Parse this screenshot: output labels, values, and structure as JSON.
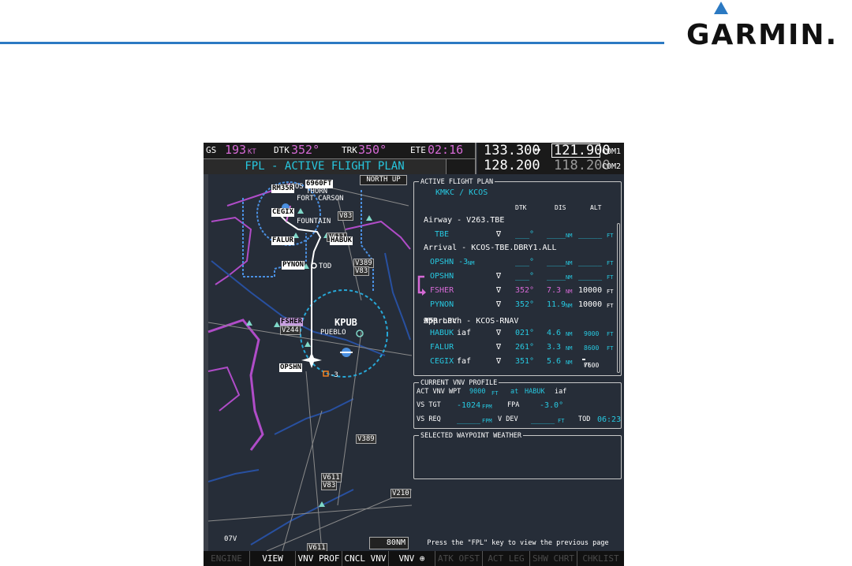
{
  "brand": {
    "logo_text": "GARMIN."
  },
  "navbar": {
    "gs_label": "GS",
    "gs_value": "193",
    "gs_unit": "KT",
    "dtk_label": "DTK",
    "dtk_value": "352°",
    "trk_label": "TRK",
    "trk_value": "350°",
    "ete_label": "ETE",
    "ete_value": "02:16",
    "page_title": "FPL - ACTIVE FLIGHT PLAN"
  },
  "com": {
    "com1_active": "133.300",
    "com1_standby": "121.900",
    "com1_label": "COM1",
    "com2_active": "128.200",
    "com2_standby": "118.200",
    "com2_label": "COM2",
    "swap_symbol": "↔"
  },
  "map": {
    "orientation": "NORTH UP",
    "range": "80NM",
    "labels": {
      "kcos": "KCOS",
      "rm": "RM35R",
      "alt": "6960FT",
      "fort": "FORT CARSON",
      "thorn": "THORN",
      "fountain": "FOUNTAIN",
      "cegix": "CEGIX",
      "falur": "FALUR",
      "habuk": "HABUK",
      "pynon": "PYNON",
      "tod": "TOD",
      "fsher": "FSHER",
      "kpub": "KPUB",
      "pueblo": "PUEBLO",
      "opshn": "OPSHN",
      "minus3": "-3",
      "v83a": "V83",
      "v611": "V611",
      "v389": "V389",
      "v83b": "V83",
      "v389b": "V389",
      "v611b": "V611",
      "v83c": "V83",
      "v210": "V210",
      "v244": "V244",
      "v611c": "V611",
      "o7v": "07V"
    }
  },
  "flight_plan": {
    "title": "ACTIVE FLIGHT PLAN",
    "route": "KMKC / KCOS",
    "col_dtk": "DTK",
    "col_dis": "DIS",
    "col_alt": "ALT",
    "airway_header": "Airway - V263.TBE",
    "arrival_header": "Arrival - KCOS-TBE.DBRY1.ALL",
    "approach_header_a": "Approach - KCOS-RNAV",
    "approach_header_gps": "GPS",
    "approach_header_b": " 35R LPV",
    "rows": [
      {
        "wpt": "TBE",
        "wpt_suffix": "",
        "dtk": "___°",
        "dis": "____",
        "dis_unit": "NM",
        "alt": "_____",
        "alt_unit": "FT"
      },
      {
        "wpt": "OPSHN -3",
        "wpt_suffix": "NM",
        "dtk": "___°",
        "dis": "____",
        "dis_unit": "NM",
        "alt": "_____",
        "alt_unit": "FT"
      },
      {
        "wpt": "OPSHN",
        "wpt_suffix": "",
        "dtk": "___°",
        "dis": "____",
        "dis_unit": "NM",
        "alt": "_____",
        "alt_unit": "FT"
      },
      {
        "wpt": "FSHER",
        "wpt_suffix": "",
        "dtk": "352°",
        "dis": "7.3",
        "dis_unit": "NM",
        "alt": "10000",
        "alt_unit": "FT"
      },
      {
        "wpt": "PYNON",
        "wpt_suffix": "",
        "dtk": "352°",
        "dis": "11.9",
        "dis_unit": "NM",
        "alt": "10000",
        "alt_unit": "FT"
      },
      {
        "wpt": "HABUK",
        "wpt_suffix": " iaf",
        "dtk": "021°",
        "dis": "4.6",
        "dis_unit": "NM",
        "alt": "9000",
        "alt_unit": "FT"
      },
      {
        "wpt": "FALUR",
        "wpt_suffix": "",
        "dtk": "261°",
        "dis": "3.3",
        "dis_unit": "NM",
        "alt": "8600",
        "alt_unit": "FT"
      },
      {
        "wpt": "CEGIX",
        "wpt_suffix": " faf",
        "dtk": "351°",
        "dis": "5.6",
        "dis_unit": "NM",
        "alt": "7600",
        "alt_unit": "FT"
      }
    ]
  },
  "vnv_profile": {
    "title": "CURRENT VNV PROFILE",
    "act_label": "ACT VNV WPT",
    "act_alt": "9000",
    "act_alt_unit": "FT",
    "at_label": "at",
    "act_wpt": "HABUK",
    "act_wpt_suffix": "iaf",
    "vs_tgt_label": "VS TGT",
    "vs_tgt": "-1024",
    "vs_tgt_unit": "FPM",
    "fpa_label": "FPA",
    "fpa": "-3.0°",
    "vs_req_label": "VS REQ",
    "vs_req": "_____",
    "vs_req_unit": "FPM",
    "vdev_label": "V DEV",
    "vdev": "_____",
    "vdev_unit": "FT",
    "tod_label": "TOD",
    "tod": "06:23"
  },
  "weather": {
    "title": "SELECTED WAYPOINT WEATHER"
  },
  "hint": "Press the \"FPL\" key to view the previous page",
  "softkeys": [
    "ENGINE",
    "VIEW",
    "VNV PROF",
    "CNCL VNV",
    "VNV ⊕",
    "ATK OFST",
    "ACT LEG",
    "SHW CHRT",
    "CHKLIST"
  ]
}
